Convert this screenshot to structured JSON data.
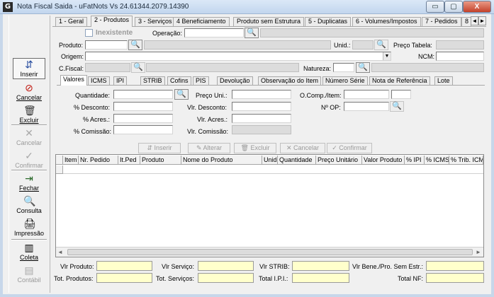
{
  "window": {
    "icon_letter": "G",
    "title": "Nota Fiscal Saida - uFatNots Vs 24.61344.2079.14390",
    "min": "▭",
    "max": "▢",
    "close": "X"
  },
  "toolbar": {
    "inserir": "Inserir",
    "cancelar_red": "Cancelar",
    "excluir": "Excluir",
    "cancelar": "Cancelar",
    "confirmar": "Confirmar",
    "fechar": "Fechar",
    "consulta": "Consulta",
    "impressao": "Impressão",
    "coleta": "Coleta",
    "contabil": "Contábil"
  },
  "tabs": [
    "1 - Geral",
    "2 - Produtos",
    "3 - Serviços",
    "4 Beneficiamento",
    "Produto sem Estrutura",
    "5 - Duplicatas",
    "6 - Volumes/Impostos",
    "7 - Pedidos",
    "8"
  ],
  "form": {
    "inexistente": "Inexistente",
    "operacao": "Operação:",
    "produto": "Produto:",
    "unid": "Unid.:",
    "preco_tabela": "Preço Tabela:",
    "origem": "Origem:",
    "ncm": "NCM:",
    "cfiscal": "C.Fiscal:",
    "natureza": "Natureza:"
  },
  "subtabs": [
    "Valores",
    "ICMS",
    "IPI",
    "STRIB",
    "Cofins",
    "PIS",
    "Devolução",
    "Observação do Item",
    "Número Série",
    "Nota de Referência",
    "Lote"
  ],
  "valores": {
    "quantidade": "Quantidade:",
    "desconto": "% Desconto:",
    "acres": "% Acres.:",
    "comissao": "% Comissão:",
    "preco_uni": "Preço Uni.:",
    "vlr_desconto": "Vlr. Desconto:",
    "vlr_acres": "Vlr. Acres.:",
    "vlr_comissao": "Vlr. Comissão:",
    "ocomp_item": "O.Comp./Item:",
    "no_op": "Nº OP:"
  },
  "actions": {
    "inserir": "Inserir",
    "alterar": "Alterar",
    "excluir": "Excluir",
    "cancelar": "Cancelar",
    "confirmar": "Confirmar"
  },
  "grid_columns": [
    "Item",
    "Nr. Pedido",
    "It.Ped",
    "Produto",
    "Nome do Produto",
    "Unid",
    "Quantidade",
    "Preço Unitário",
    "Valor Produto",
    "% IPI",
    "% ICMS",
    "% Trib. ICM"
  ],
  "totals": {
    "vlr_produto": "Vlr Produto:",
    "vlr_servico": "Vlr Serviço:",
    "vlr_strib": "Vlr STRIB:",
    "vlr_bene": "Vlr Bene./Pro. Sem Estr.:",
    "tot_produtos": "Tot. Produtos:",
    "tot_servicos": "Tot. Serviços:",
    "total_ipi": "Total I.P.I.:",
    "total_nf": "Total NF:"
  },
  "colors": {
    "accent": "#c7d7ea",
    "totals_bg": "#ffffcc",
    "close": "#c4412a"
  }
}
